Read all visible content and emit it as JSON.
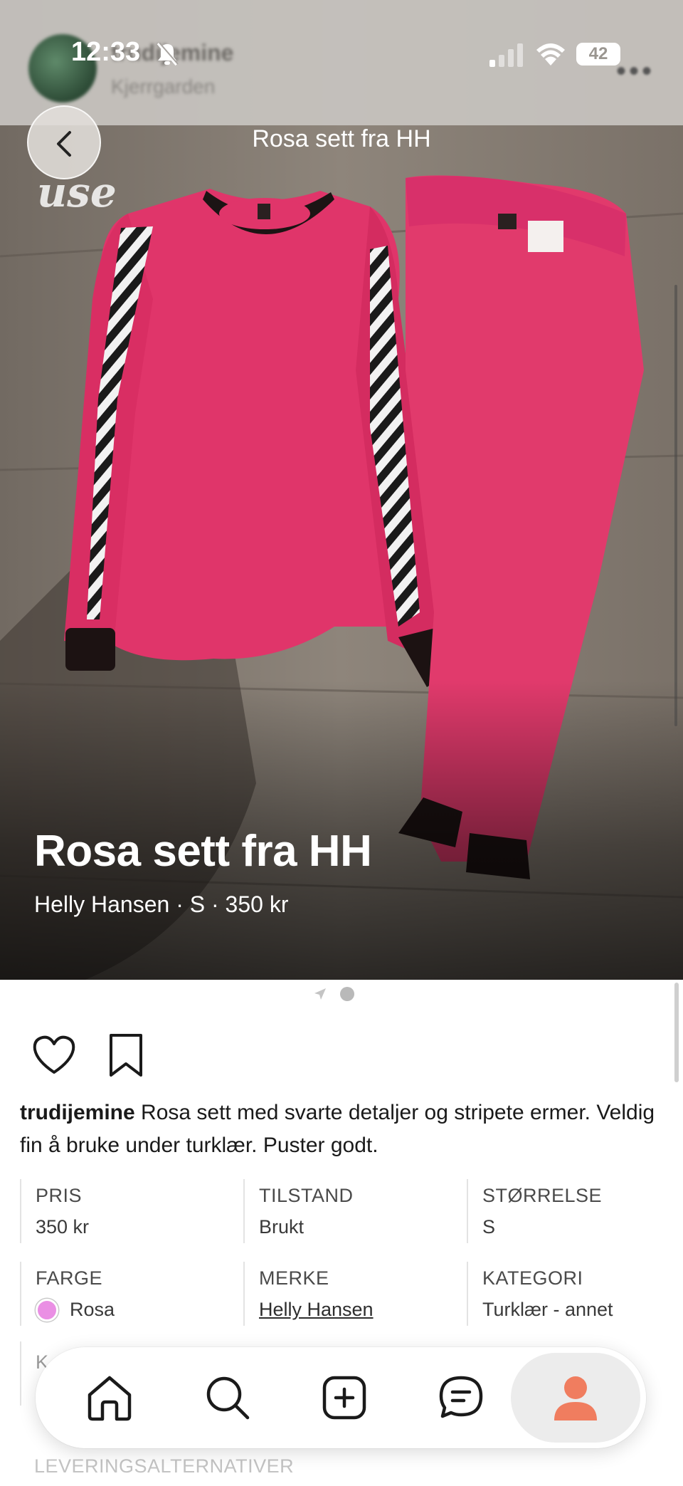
{
  "status_bar": {
    "time": "12:33",
    "battery": "42"
  },
  "seller": {
    "username": "trudijemine",
    "location": "Kjerrgarden"
  },
  "nav": {
    "title": "Rosa sett fra HH"
  },
  "watermark": "use",
  "listing": {
    "title": "Rosa sett fra HH",
    "subtitle": "Helly Hansen · S · 350 kr",
    "description": "Rosa sett med svarte detaljer og stripete ermer. Veldig fin å bruke under turklær. Puster godt.",
    "details": [
      {
        "label": "PRIS",
        "value": "350 kr"
      },
      {
        "label": "TILSTAND",
        "value": "Brukt"
      },
      {
        "label": "STØRRELSE",
        "value": "S"
      },
      {
        "label": "FARGE",
        "value": "Rosa",
        "swatch": "#ea8fe4"
      },
      {
        "label": "MERKE",
        "value": "Helly Hansen"
      },
      {
        "label": "KATEGORI",
        "value": "Turklær - annet"
      }
    ],
    "partial_label": "K",
    "delivery_heading": "LEVERINGSALTERNATIVER"
  },
  "icons": {
    "back": "chevron-left-icon",
    "like": "heart-icon",
    "save": "bookmark-icon",
    "home": "home-icon",
    "search": "search-icon",
    "create": "plus-square-icon",
    "messages": "chat-icon",
    "profile": "person-icon"
  },
  "colors": {
    "accent": "#f07d5f",
    "product": "#e23a6c",
    "active_tab_bg": "#ececec"
  }
}
